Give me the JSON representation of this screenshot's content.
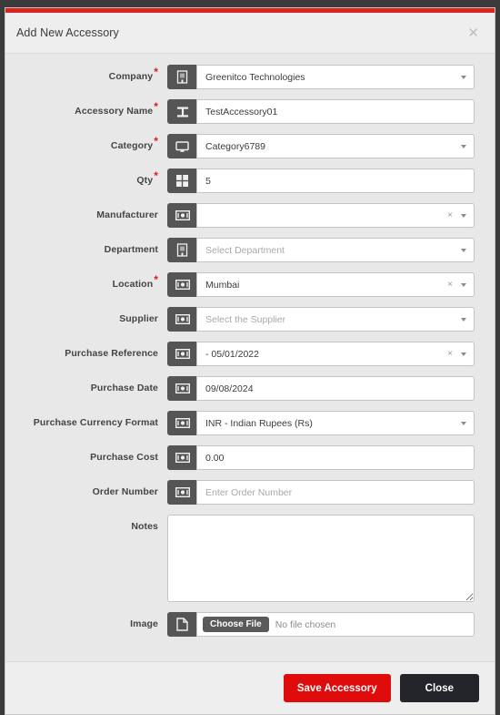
{
  "theme": {
    "accent_red": "#d9241f",
    "save_button_red": "#e00c0c",
    "close_button_dark": "#23252a",
    "addon_gray": "#555555",
    "modal_bg": "#e8e8e8",
    "required_star": "#e01b1b"
  },
  "header": {
    "title": "Add New Accessory",
    "close_icon": "close-icon"
  },
  "fields": [
    {
      "label": "Company",
      "required": true,
      "icon": "building-icon",
      "value": "Greenitco Technologies",
      "placeholder": "",
      "type": "select",
      "has_clear": false,
      "has_caret": true
    },
    {
      "label": "Accessory Name",
      "required": true,
      "icon": "text-format-icon",
      "value": "TestAccessory01",
      "placeholder": "",
      "type": "text",
      "has_clear": false,
      "has_caret": false
    },
    {
      "label": "Category",
      "required": true,
      "icon": "monitor-icon",
      "value": "Category6789",
      "placeholder": "",
      "type": "select",
      "has_clear": false,
      "has_caret": true
    },
    {
      "label": "Qty",
      "required": true,
      "icon": "grid-icon",
      "value": "5",
      "placeholder": "",
      "type": "text",
      "has_clear": false,
      "has_caret": false
    },
    {
      "label": "Manufacturer",
      "required": false,
      "icon": "money-icon",
      "value": "",
      "placeholder": "",
      "type": "select",
      "has_clear": true,
      "has_caret": true
    },
    {
      "label": "Department",
      "required": false,
      "icon": "building-icon",
      "value": "",
      "placeholder": "Select Department",
      "type": "select",
      "has_clear": false,
      "has_caret": true
    },
    {
      "label": "Location",
      "required": true,
      "icon": "money-icon",
      "value": "Mumbai",
      "placeholder": "",
      "type": "select",
      "has_clear": true,
      "has_caret": true
    },
    {
      "label": "Supplier",
      "required": false,
      "icon": "money-icon",
      "value": "",
      "placeholder": "Select the Supplier",
      "type": "select",
      "has_clear": false,
      "has_caret": true
    },
    {
      "label": "Purchase Reference",
      "required": false,
      "icon": "money-icon",
      "value": "- 05/01/2022",
      "placeholder": "",
      "type": "select",
      "has_clear": true,
      "has_caret": true
    },
    {
      "label": "Purchase Date",
      "required": false,
      "icon": "money-icon",
      "value": "09/08/2024",
      "placeholder": "",
      "type": "text",
      "has_clear": false,
      "has_caret": false
    },
    {
      "label": "Purchase Currency Format",
      "required": false,
      "icon": "money-icon",
      "value": "INR - Indian Rupees (Rs)",
      "placeholder": "",
      "type": "select",
      "has_clear": false,
      "has_caret": true
    },
    {
      "label": "Purchase Cost",
      "required": false,
      "icon": "money-icon",
      "value": "0.00",
      "placeholder": "",
      "type": "text",
      "has_clear": false,
      "has_caret": false
    },
    {
      "label": "Order Number",
      "required": false,
      "icon": "money-icon",
      "value": "",
      "placeholder": "Enter Order Number",
      "type": "text",
      "has_clear": false,
      "has_caret": false
    }
  ],
  "notes": {
    "label": "Notes",
    "value": "",
    "placeholder": ""
  },
  "image": {
    "label": "Image",
    "icon": "file-icon",
    "choose_label": "Choose File",
    "no_file_label": "No file chosen"
  },
  "footer": {
    "save_label": "Save Accessory",
    "close_label": "Close"
  }
}
